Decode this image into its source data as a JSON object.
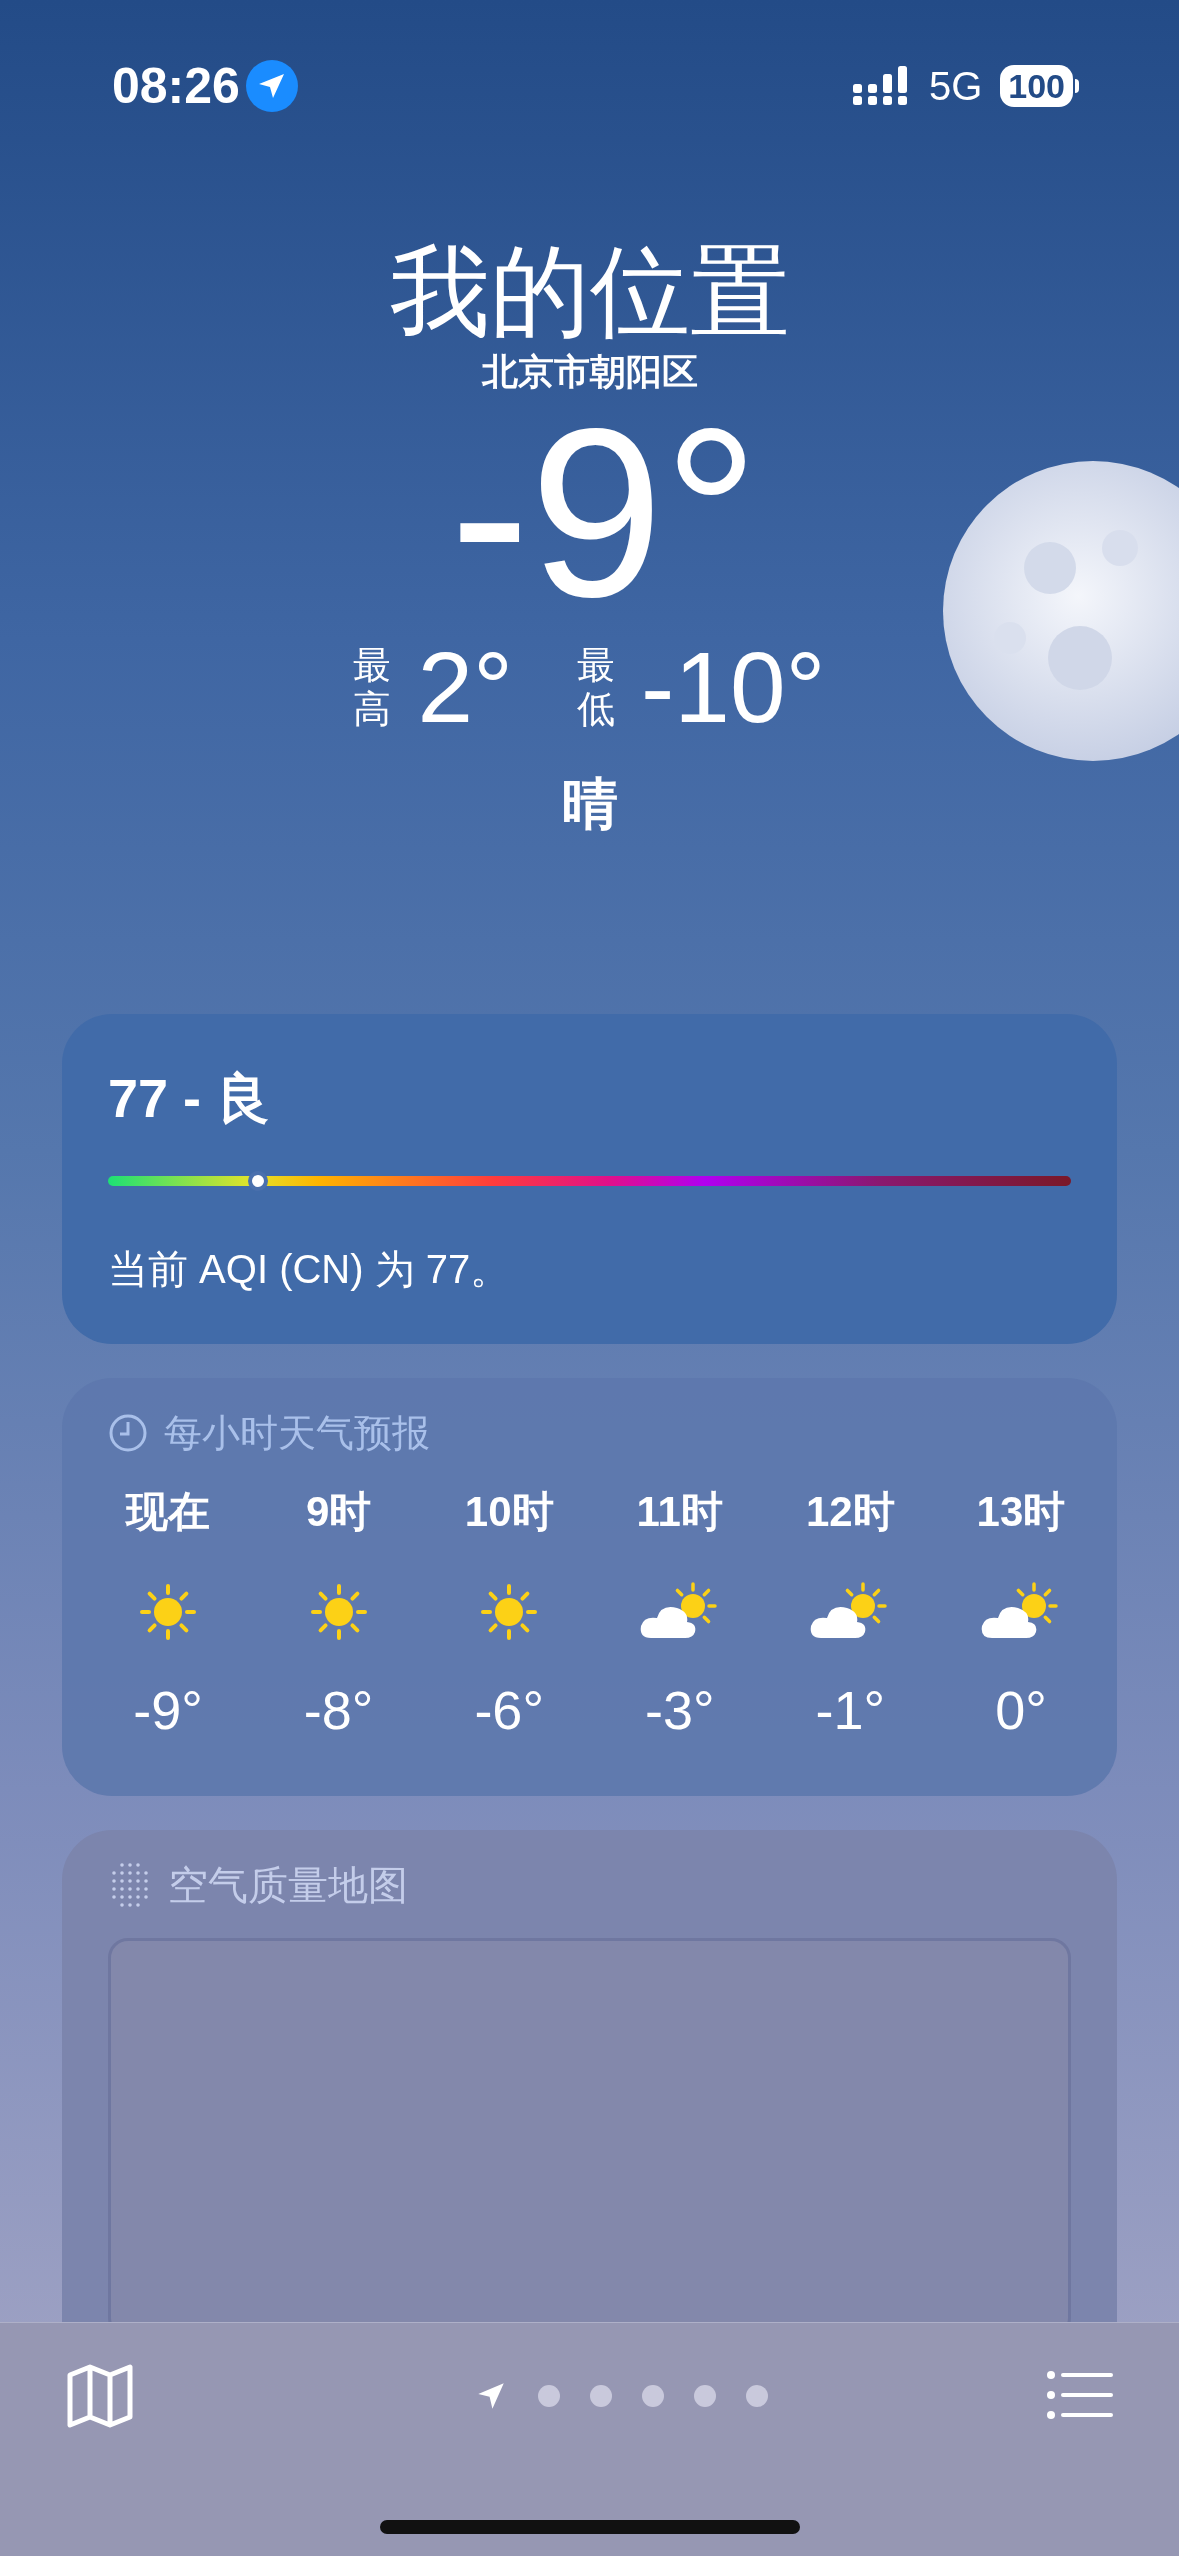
{
  "status_bar": {
    "time": "08:26",
    "network": "5G",
    "battery": "100"
  },
  "location": {
    "title": "我的位置",
    "subtitle": "北京市朝阳区",
    "temperature": "-9°",
    "high_label": "最高",
    "high": "2°",
    "low_label": "最低",
    "low": "-10°",
    "condition": "晴"
  },
  "aqi": {
    "title": "77 - 良",
    "level": 0.156,
    "description": "当前 AQI (CN) 为 77。"
  },
  "hourly": {
    "title": "每小时天气预报",
    "hours": [
      {
        "label": "现在",
        "kind": "sun",
        "temp": "-9°"
      },
      {
        "label": "9时",
        "kind": "sun",
        "temp": "-8°"
      },
      {
        "label": "10时",
        "kind": "sun",
        "temp": "-6°"
      },
      {
        "label": "11时",
        "kind": "partly_cloudy",
        "temp": "-3°"
      },
      {
        "label": "12时",
        "kind": "partly_cloudy",
        "temp": "-1°"
      },
      {
        "label": "13时",
        "kind": "partly_cloudy",
        "temp": "0°"
      }
    ]
  },
  "air_map": {
    "title": "空气质量地图"
  },
  "pages": [
    {
      "kind": "location",
      "selected": true
    },
    {
      "kind": "dot",
      "selected": false
    },
    {
      "kind": "dot",
      "selected": false
    },
    {
      "kind": "dot",
      "selected": false
    },
    {
      "kind": "dot",
      "selected": false
    },
    {
      "kind": "dot",
      "selected": false
    }
  ]
}
